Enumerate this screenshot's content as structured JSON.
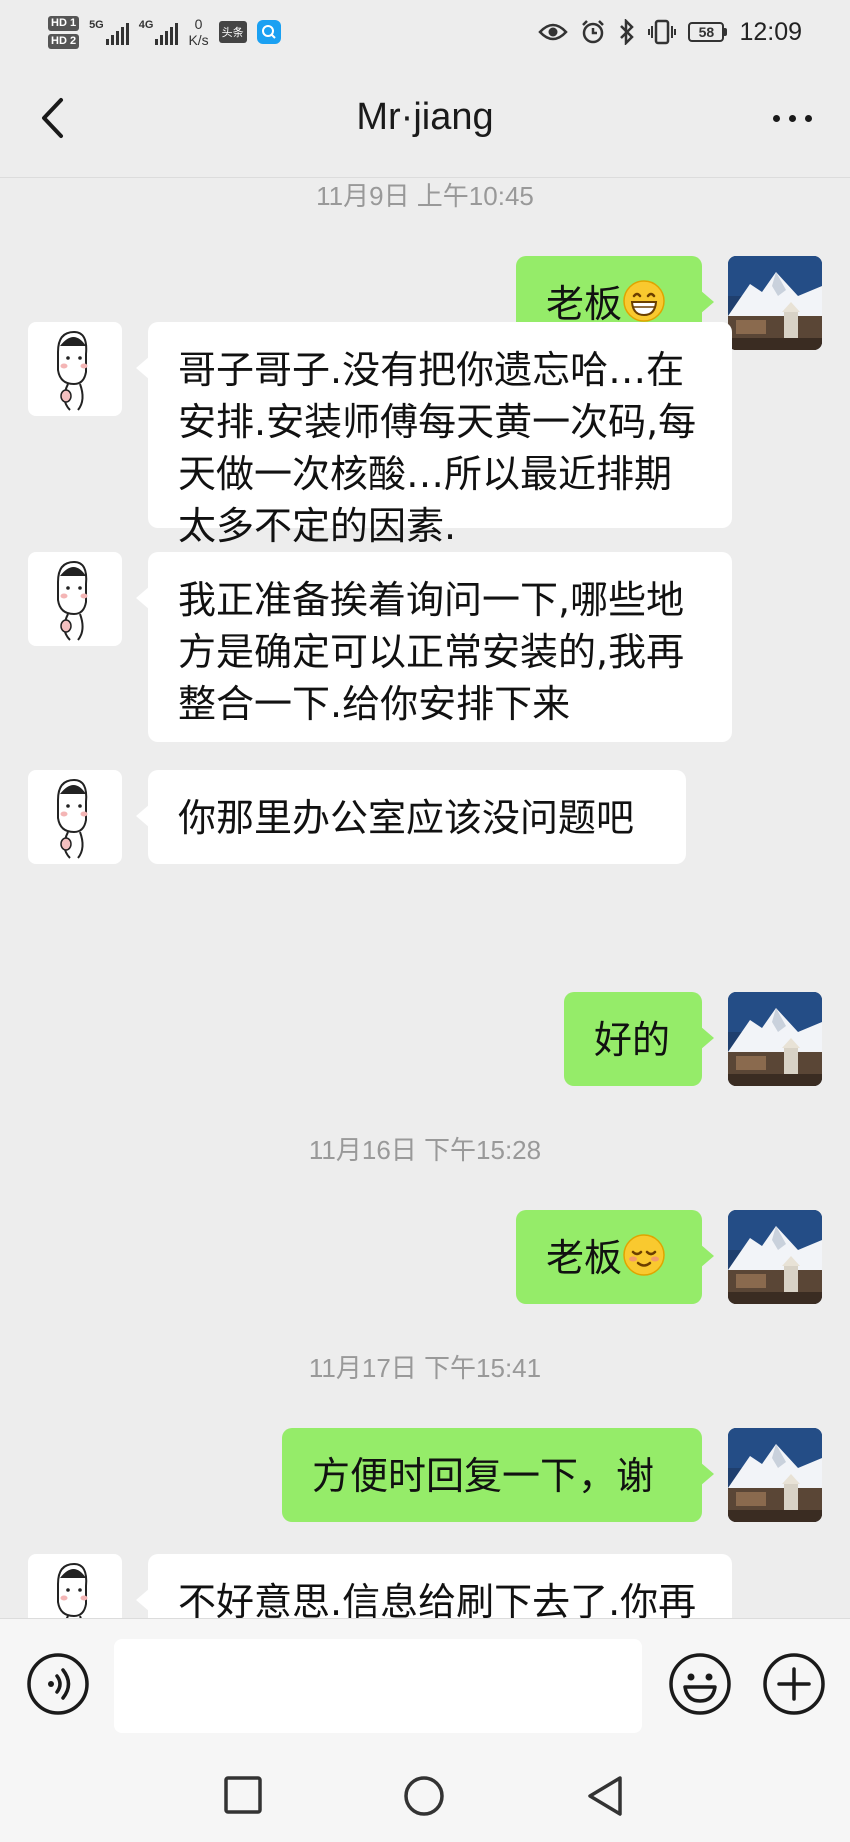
{
  "status_bar": {
    "hd1": "HD 1",
    "hd2": "HD 2",
    "signal1": "5G",
    "signal2": "4G",
    "speed_value": "0",
    "speed_unit": "K/s",
    "app_badge": "头条",
    "battery": "58",
    "time": "12:09"
  },
  "header": {
    "title": "Mr·jiang",
    "back_icon": "chevron-left-icon",
    "more_icon": "ellipsis-icon"
  },
  "messages": {
    "ts1": "11月9日 上午10:45",
    "m1_text": "老板",
    "m2_l1": "哥子哥子.没有把你遗忘哈…在",
    "m2_l2": "安排.安装师傅每天黄一次码,每",
    "m2_l3": "天做一次核酸…所以最近排期",
    "m2_l4": "太多不定的因素.",
    "m3_l1": "我正准备挨着询问一下,哪些地",
    "m3_l2": "方是确定可以正常安装的,我再",
    "m3_l3": "整合一下.给你安排下来",
    "m4_text": "你那里办公室应该没问题吧",
    "m5_text": "好的",
    "ts2": "11月16日 下午15:28",
    "m6_text": "老板",
    "ts3": "11月17日 下午15:41",
    "m7_text": "方便时回复一下，谢",
    "m8_text": "不好意思.信息给刷下去了.你再"
  },
  "input_bar": {
    "placeholder": "",
    "voice_icon": "voice-icon",
    "emoji_icon": "smiley-icon",
    "plus_icon": "plus-icon"
  },
  "colors": {
    "background": "#ededed",
    "my_bubble": "#95ec69",
    "their_bubble": "#ffffff",
    "timestamp": "#999999"
  }
}
